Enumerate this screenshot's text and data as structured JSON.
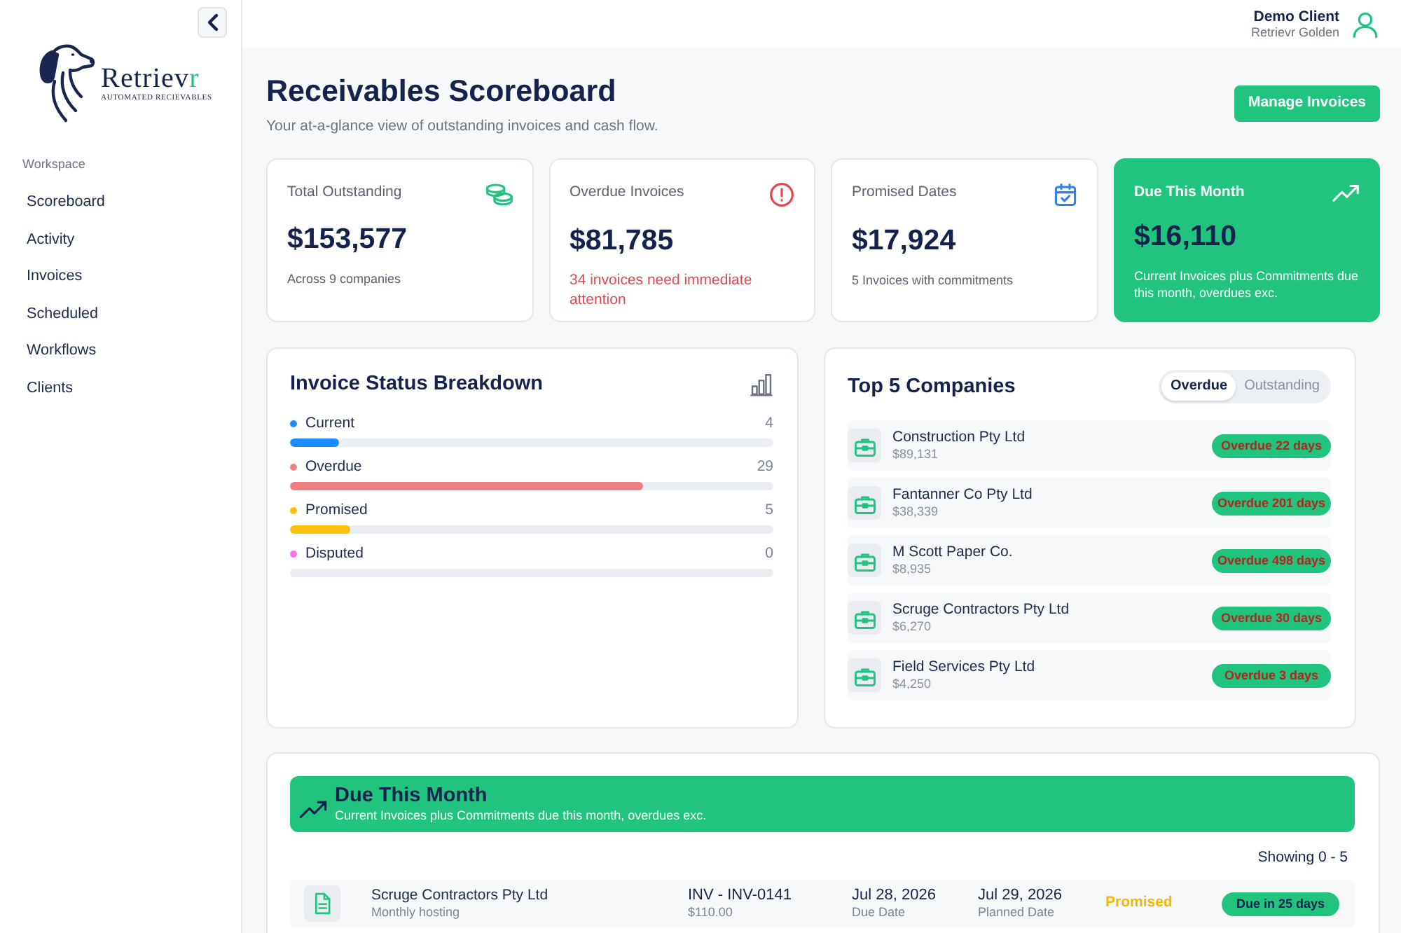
{
  "sidebar": {
    "brand": {
      "name": "Retriev",
      "name_accent": "r",
      "tagline": "AUTOMATED RECIEVABLES"
    },
    "section_label": "Workspace",
    "items": [
      {
        "label": "Scoreboard"
      },
      {
        "label": "Activity"
      },
      {
        "label": "Invoices"
      },
      {
        "label": "Scheduled"
      },
      {
        "label": "Workflows"
      },
      {
        "label": "Clients"
      }
    ]
  },
  "header": {
    "user_name": "Demo Client",
    "user_org": "Retrievr Golden"
  },
  "page": {
    "title": "Receivables Scoreboard",
    "subtitle": "Your at-a-glance view of outstanding invoices and cash flow.",
    "action": "Manage Invoices"
  },
  "stat_cards": [
    {
      "kind": "total",
      "label": "Total Outstanding",
      "value": "$153,577",
      "note": "Across 9 companies"
    },
    {
      "kind": "overdue",
      "label": "Overdue Invoices",
      "value": "$81,785",
      "note": "34 invoices need immediate attention"
    },
    {
      "kind": "promised",
      "label": "Promised Dates",
      "value": "$17,924",
      "note": "5 Invoices with commitments"
    },
    {
      "kind": "due",
      "label": "Due This Month",
      "value": "$16,110",
      "note": "Current Invoices plus Commitments due this month, overdues exc."
    }
  ],
  "status_breakdown": {
    "title": "Invoice Status Breakdown",
    "items": [
      {
        "label": "Current",
        "count": "4",
        "level": 0.1,
        "color": "#1a8cff"
      },
      {
        "label": "Overdue",
        "count": "29",
        "level": 0.73,
        "color": "#f08080"
      },
      {
        "label": "Promised",
        "count": "5",
        "level": 0.125,
        "color": "#ffc107"
      },
      {
        "label": "Disputed",
        "count": "0",
        "level": 0,
        "color": "#f472f0"
      }
    ]
  },
  "top_companies": {
    "title": "Top 5 Companies",
    "toggle": [
      {
        "label": "Overdue",
        "selected": true
      },
      {
        "label": "Outstanding",
        "selected": false
      }
    ],
    "rows": [
      {
        "name": "Construction Pty Ltd",
        "amount": "$89,131",
        "badge": "Overdue 22 days"
      },
      {
        "name": "Fantanner Co Pty Ltd",
        "amount": "$38,339",
        "badge": "Overdue 201 days"
      },
      {
        "name": "M Scott Paper Co.",
        "amount": "$8,935",
        "badge": "Overdue 498 days"
      },
      {
        "name": "Scruge Contractors Pty Ltd",
        "amount": "$6,270",
        "badge": "Overdue 30 days"
      },
      {
        "name": "Field Services Pty Ltd",
        "amount": "$4,250",
        "badge": "Overdue 3 days"
      }
    ]
  },
  "due_this_month": {
    "title": "Due This Month",
    "subtitle": "Current Invoices plus Commitments due this month, overdues exc.",
    "showing": "Showing 0 - 5",
    "rows": [
      {
        "company": "Scruge Contractors Pty Ltd",
        "description": "Monthly hosting",
        "invoice": "INV - INV-0141",
        "amount": "$110.00",
        "due_date": "Jul 28, 2026",
        "due_label": "Due Date",
        "planned_date": "Jul 29, 2026",
        "planned_label": "Planned Date",
        "status": "Promised",
        "badge": "Due in 25 days"
      }
    ]
  }
}
